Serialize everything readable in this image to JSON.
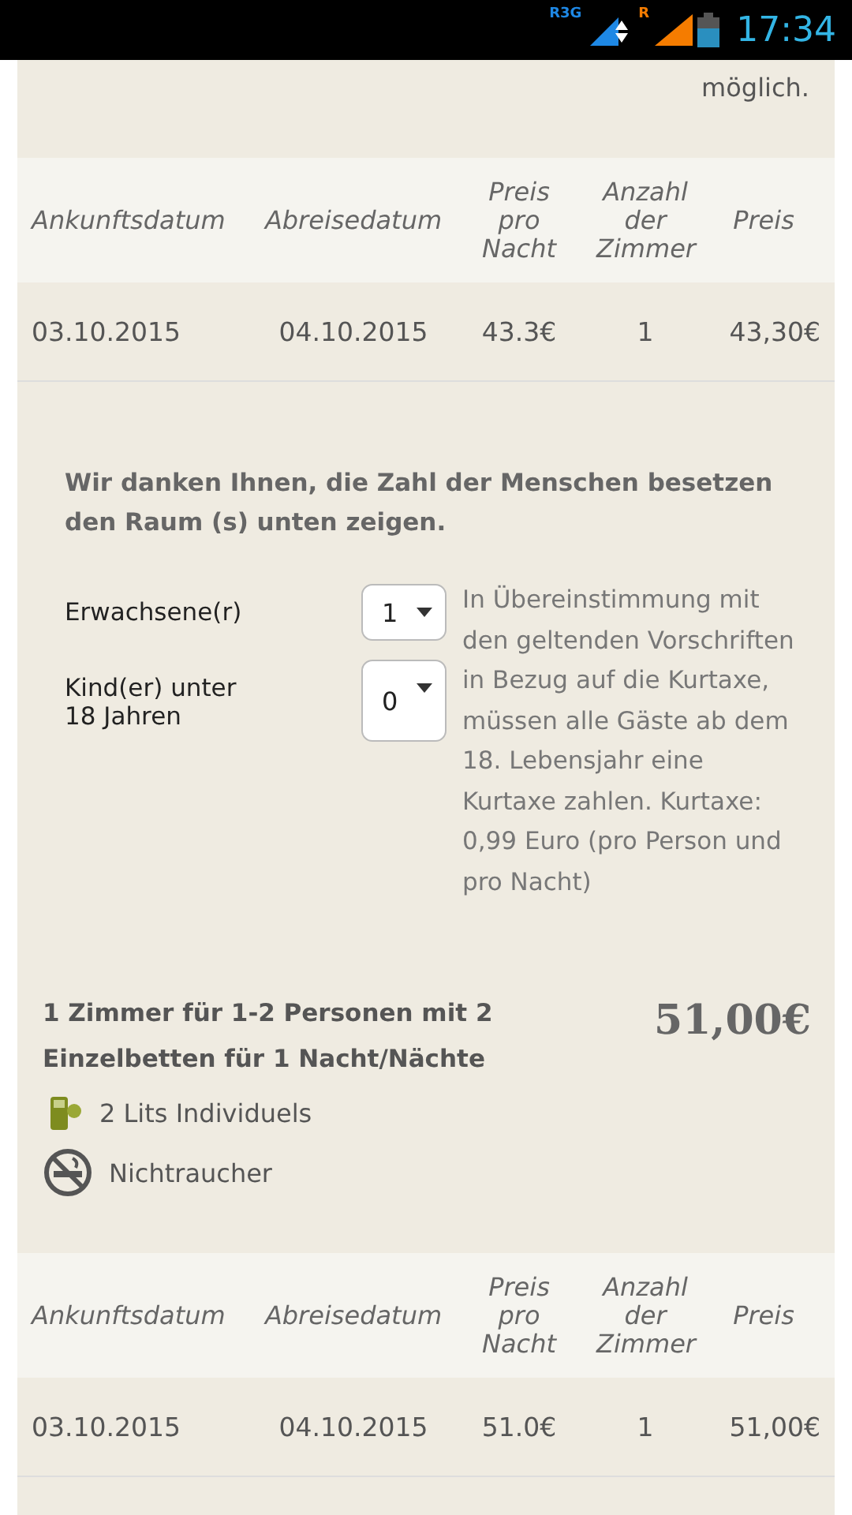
{
  "status_bar": {
    "network_label": "R3G",
    "roaming_label": "R",
    "time": "17:34"
  },
  "refund_note": "möglich.",
  "tables": [
    {
      "columns": [
        "Ankunftsdatum",
        "Abreisedatum",
        "Preis pro Nacht",
        "Anzahl der Zimmer",
        "Preis"
      ],
      "rows": [
        [
          "03.10.2015",
          "04.10.2015",
          "43.3€",
          "1",
          "43,30€"
        ]
      ]
    }
  ],
  "guests": {
    "intro": "Wir danken Ihnen, die Zahl der Menschen besetzen den Raum (s) unten zeigen.",
    "fields": [
      {
        "label": "Erwachsene(r)",
        "value": "1"
      },
      {
        "label": "Kind(er) unter 18 Jahren",
        "value": "0"
      }
    ],
    "note": "In Übereinstimmung mit den geltenden Vorschriften in Bezug auf die Kurtaxe, müssen alle Gäste ab dem 18. Lebensjahr eine Kurtaxe zahlen. Kurtaxe: 0,99 Euro (pro Person und pro Nacht)"
  },
  "room": {
    "title": "1 Zimmer für 1-2 Personen mit 2 Einzelbetten für 1 Nacht/Nächte",
    "price": "51,00€",
    "features": [
      {
        "kind": "beds",
        "label": "2 Lits Individuels"
      },
      {
        "kind": "nonsmoking",
        "label": "Nichtraucher"
      }
    ]
  },
  "tables_2": [
    {
      "columns": [
        "Ankunftsdatum",
        "Abreisedatum",
        "Preis pro Nacht",
        "Anzahl der Zimmer",
        "Preis"
      ],
      "rows": [
        [
          "03.10.2015",
          "04.10.2015",
          "51.0€",
          "1",
          "51,00€"
        ]
      ]
    }
  ]
}
